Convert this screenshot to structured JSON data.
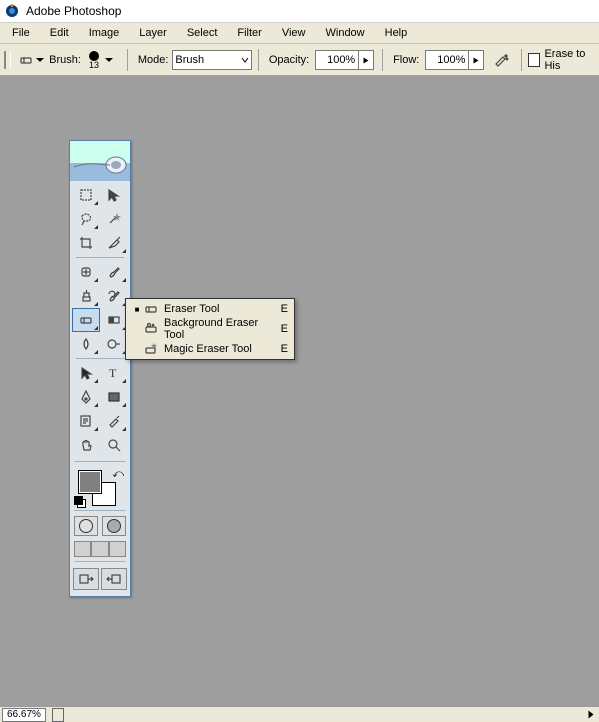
{
  "title": "Adobe Photoshop",
  "menubar": [
    "File",
    "Edit",
    "Image",
    "Layer",
    "Select",
    "Filter",
    "View",
    "Window",
    "Help"
  ],
  "options": {
    "brush_label": "Brush:",
    "brush_size": "13",
    "mode_label": "Mode:",
    "mode_value": "Brush",
    "opacity_label": "Opacity:",
    "opacity_value": "100%",
    "flow_label": "Flow:",
    "flow_value": "100%",
    "erase_hist_label": "Erase to His"
  },
  "flyout": [
    {
      "label": "Eraser Tool",
      "key": "E",
      "selected": true
    },
    {
      "label": "Background Eraser Tool",
      "key": "E",
      "selected": false
    },
    {
      "label": "Magic Eraser Tool",
      "key": "E",
      "selected": false
    }
  ],
  "status": {
    "zoom": "66.67%"
  },
  "tool_names": [
    [
      "marquee",
      "move"
    ],
    [
      "lasso",
      "wand"
    ],
    [
      "crop",
      "slice"
    ],
    [
      "healing",
      "brush"
    ],
    [
      "stamp",
      "history-brush"
    ],
    [
      "eraser",
      "gradient"
    ],
    [
      "blur",
      "dodge"
    ],
    [
      "path-select",
      "type"
    ],
    [
      "pen",
      "shape"
    ],
    [
      "notes",
      "eyedropper"
    ],
    [
      "hand",
      "zoom"
    ]
  ]
}
